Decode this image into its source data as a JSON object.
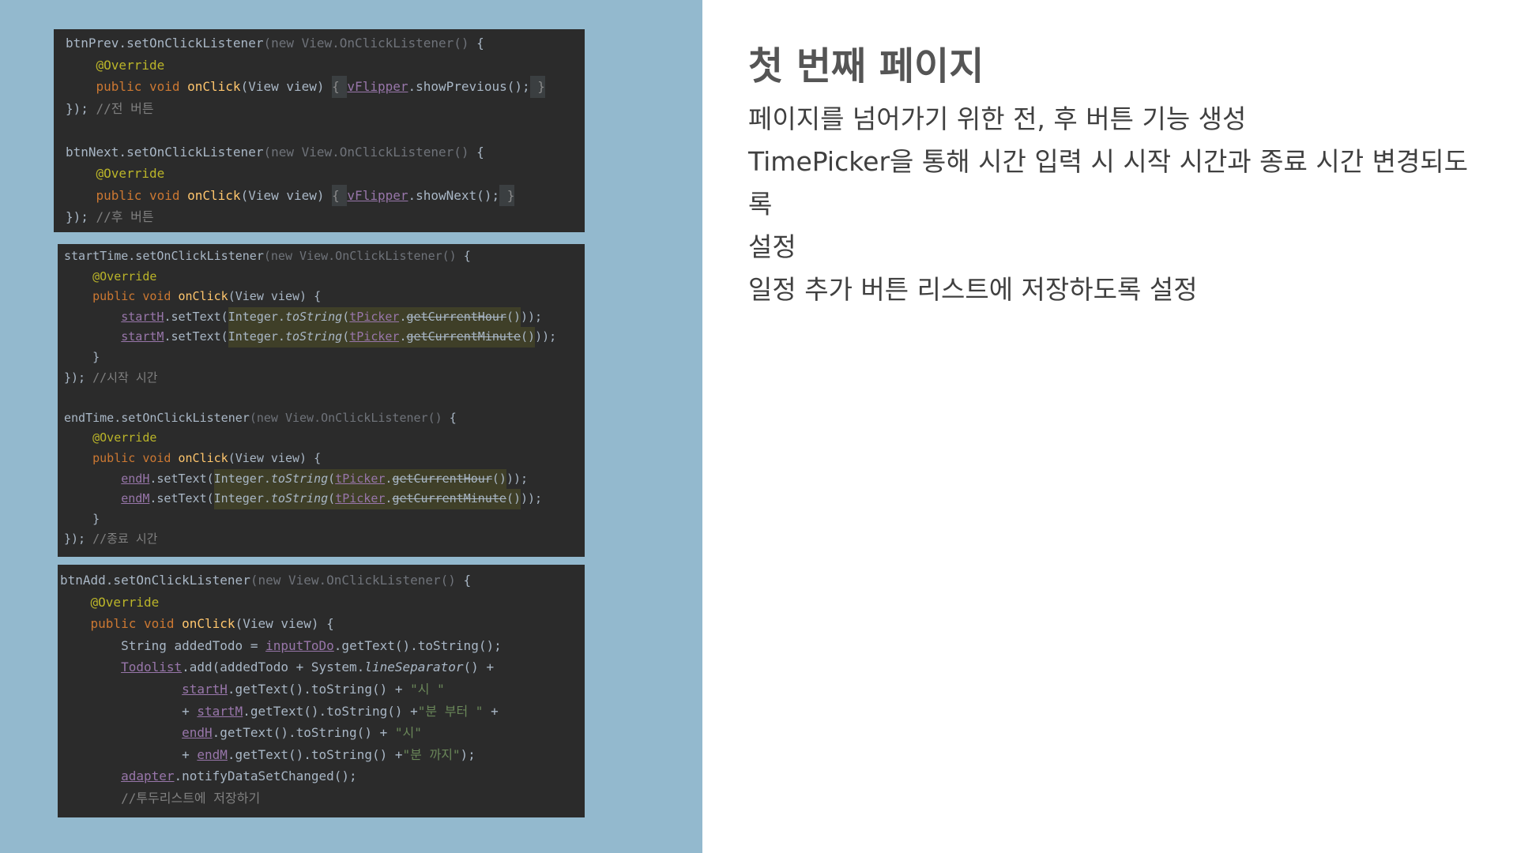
{
  "slide": {
    "title": "첫 번째 페이지",
    "description_lines": [
      "페이지를 넘어가기 위한 전, 후 버튼 기능 생성",
      "TimePicker을 통해 시간 입력 시 시작 시간과 종료 시간 변경되도록",
      "설정",
      "일정 추가 버튼 리스트에 저장하도록 설정"
    ]
  },
  "colors": {
    "left_panel_bg": "#93b9ce",
    "editor_bg": "#2b2b2b",
    "keyword": "#cc7832",
    "annotation": "#bbb529",
    "method": "#ffc66d",
    "field": "#9876aa",
    "string": "#6a8759",
    "comment": "#808080"
  },
  "code_blocks": [
    {
      "lines": [
        [
          [
            "btnPrev.setOnClickListener",
            "p"
          ],
          [
            "(new View.OnClickListener() ",
            "dim"
          ],
          [
            "{",
            "p"
          ]
        ],
        [
          [
            "    ",
            "p"
          ],
          [
            "@Override",
            "ann"
          ]
        ],
        [
          [
            "    ",
            "p"
          ],
          [
            "public void ",
            "kw"
          ],
          [
            "onClick",
            "fn"
          ],
          [
            "(View view) ",
            "p"
          ],
          [
            "{ ",
            "fold"
          ],
          [
            "vFlipper",
            "fld"
          ],
          [
            ".showPrevious();",
            "p"
          ],
          [
            " }",
            "fold"
          ]
        ],
        [
          [
            "});",
            "p"
          ],
          [
            " //전 버튼",
            "cm"
          ]
        ],
        [],
        [
          [
            "btnNext.setOnClickListener",
            "p"
          ],
          [
            "(new View.OnClickListener() ",
            "dim"
          ],
          [
            "{",
            "p"
          ]
        ],
        [
          [
            "    ",
            "p"
          ],
          [
            "@Override",
            "ann"
          ]
        ],
        [
          [
            "    ",
            "p"
          ],
          [
            "public void ",
            "kw"
          ],
          [
            "onClick",
            "fn"
          ],
          [
            "(View view) ",
            "p"
          ],
          [
            "{ ",
            "fold"
          ],
          [
            "vFlipper",
            "fld"
          ],
          [
            ".showNext();",
            "p"
          ],
          [
            " }",
            "fold"
          ]
        ],
        [
          [
            "});",
            "p"
          ],
          [
            " //후 버튼",
            "cm"
          ]
        ]
      ]
    },
    {
      "lines": [
        [
          [
            "startTime.setOnClickListener",
            "p"
          ],
          [
            "(new View.OnClickListener() ",
            "dim"
          ],
          [
            "{",
            "p"
          ]
        ],
        [
          [
            "    ",
            "p"
          ],
          [
            "@Override",
            "ann"
          ]
        ],
        [
          [
            "    ",
            "p"
          ],
          [
            "public void ",
            "kw"
          ],
          [
            "onClick",
            "fn"
          ],
          [
            "(View view) {",
            "p"
          ]
        ],
        [
          [
            "        ",
            "p"
          ],
          [
            "startH",
            "fld"
          ],
          [
            ".setText(",
            "p"
          ],
          [
            "Integer.",
            "hl"
          ],
          [
            "toString",
            "hl ital"
          ],
          [
            "(",
            "hl"
          ],
          [
            "tPicker",
            "hl fld"
          ],
          [
            ".",
            "hl"
          ],
          [
            "getCurrentHour",
            "hl strike"
          ],
          [
            "()",
            "hl"
          ],
          [
            "));",
            "p"
          ]
        ],
        [
          [
            "        ",
            "p"
          ],
          [
            "startM",
            "fld"
          ],
          [
            ".setText(",
            "p"
          ],
          [
            "Integer.",
            "hl"
          ],
          [
            "toString",
            "hl ital"
          ],
          [
            "(",
            "hl"
          ],
          [
            "tPicker",
            "hl fld"
          ],
          [
            ".",
            "hl"
          ],
          [
            "getCurrentMinute",
            "hl strike"
          ],
          [
            "()",
            "hl"
          ],
          [
            "));",
            "p"
          ]
        ],
        [
          [
            "    }",
            "p"
          ]
        ],
        [
          [
            "});",
            "p"
          ],
          [
            " //시작 시간",
            "cm"
          ]
        ],
        [],
        [
          [
            "endTime.setOnClickListener",
            "p"
          ],
          [
            "(new View.OnClickListener() ",
            "dim"
          ],
          [
            "{",
            "p"
          ]
        ],
        [
          [
            "    ",
            "p"
          ],
          [
            "@Override",
            "ann"
          ]
        ],
        [
          [
            "    ",
            "p"
          ],
          [
            "public void ",
            "kw"
          ],
          [
            "onClick",
            "fn"
          ],
          [
            "(View view) {",
            "p"
          ]
        ],
        [
          [
            "        ",
            "p"
          ],
          [
            "endH",
            "fld"
          ],
          [
            ".setText(",
            "p"
          ],
          [
            "Integer.",
            "hl"
          ],
          [
            "toString",
            "hl ital"
          ],
          [
            "(",
            "hl"
          ],
          [
            "tPicker",
            "hl fld"
          ],
          [
            ".",
            "hl"
          ],
          [
            "getCurrentHour",
            "hl strike"
          ],
          [
            "()",
            "hl"
          ],
          [
            "));",
            "p"
          ]
        ],
        [
          [
            "        ",
            "p"
          ],
          [
            "endM",
            "fld"
          ],
          [
            ".setText(",
            "p"
          ],
          [
            "Integer.",
            "hl"
          ],
          [
            "toString",
            "hl ital"
          ],
          [
            "(",
            "hl"
          ],
          [
            "tPicker",
            "hl fld"
          ],
          [
            ".",
            "hl"
          ],
          [
            "getCurrentMinute",
            "hl strike"
          ],
          [
            "()",
            "hl"
          ],
          [
            "));",
            "p"
          ]
        ],
        [
          [
            "    }",
            "p"
          ]
        ],
        [
          [
            "});",
            "p"
          ],
          [
            " //종료 시간",
            "cm"
          ]
        ]
      ]
    },
    {
      "lines": [
        [
          [
            "btnAdd.setOnClickListener",
            "p"
          ],
          [
            "(new View.OnClickListener() ",
            "dim"
          ],
          [
            "{",
            "p"
          ]
        ],
        [
          [
            "    ",
            "p"
          ],
          [
            "@Override",
            "ann"
          ]
        ],
        [
          [
            "    ",
            "p"
          ],
          [
            "public void ",
            "kw"
          ],
          [
            "onClick",
            "fn"
          ],
          [
            "(View view) {",
            "p"
          ]
        ],
        [
          [
            "        String addedTodo = ",
            "p"
          ],
          [
            "inputToDo",
            "fld"
          ],
          [
            ".getText().toString();",
            "p"
          ]
        ],
        [
          [
            "        ",
            "p"
          ],
          [
            "Todolist",
            "fld"
          ],
          [
            ".add(addedTodo + System.",
            "p"
          ],
          [
            "lineSeparator",
            "ital"
          ],
          [
            "() +",
            "p"
          ]
        ],
        [
          [
            "                ",
            "p"
          ],
          [
            "startH",
            "fld"
          ],
          [
            ".getText().toString() + ",
            "p"
          ],
          [
            "\"시 \"",
            "str"
          ]
        ],
        [
          [
            "                + ",
            "p"
          ],
          [
            "startM",
            "fld"
          ],
          [
            ".getText().toString() +",
            "p"
          ],
          [
            "\"분 부터 \"",
            "str"
          ],
          [
            " +",
            "p"
          ]
        ],
        [
          [
            "                ",
            "p"
          ],
          [
            "endH",
            "fld"
          ],
          [
            ".getText().toString() + ",
            "p"
          ],
          [
            "\"시\"",
            "str"
          ]
        ],
        [
          [
            "                + ",
            "p"
          ],
          [
            "endM",
            "fld"
          ],
          [
            ".getText().toString() +",
            "p"
          ],
          [
            "\"분 까지\"",
            "str"
          ],
          [
            ");",
            "p"
          ]
        ],
        [
          [
            "        ",
            "p"
          ],
          [
            "adapter",
            "fld"
          ],
          [
            ".notifyDataSetChanged();",
            "p"
          ]
        ],
        [
          [
            "        //투두리스트에 저장하기",
            "cm"
          ]
        ]
      ]
    }
  ]
}
